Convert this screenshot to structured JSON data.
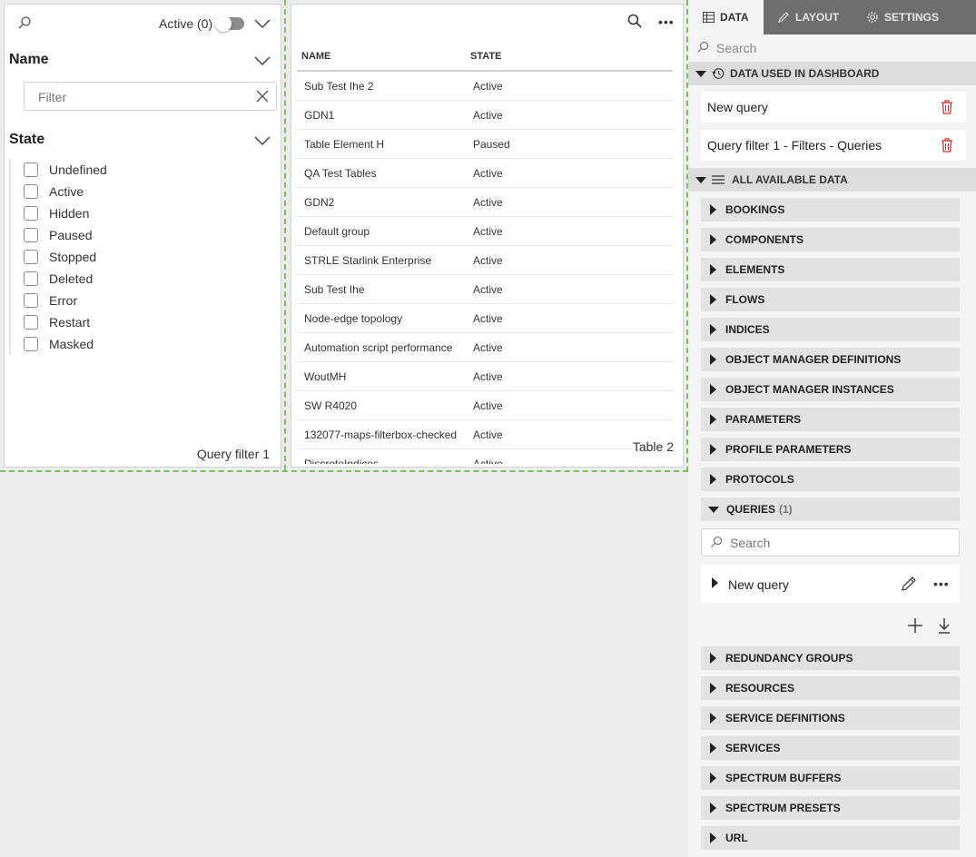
{
  "query_filter": {
    "active_toggle_label": "Active (0)",
    "sections": {
      "name_title": "Name",
      "name_filter_placeholder": "Filter",
      "state_title": "State"
    },
    "states": [
      "Undefined",
      "Active",
      "Hidden",
      "Paused",
      "Stopped",
      "Deleted",
      "Error",
      "Restart",
      "Masked"
    ],
    "caption": "Query filter 1"
  },
  "table": {
    "columns": [
      "NAME",
      "STATE"
    ],
    "rows": [
      {
        "name": "Sub Test Ihe 2",
        "state": "Active"
      },
      {
        "name": "GDN1",
        "state": "Active"
      },
      {
        "name": "Table Element H",
        "state": "Paused"
      },
      {
        "name": "QA Test Tables",
        "state": "Active"
      },
      {
        "name": "GDN2",
        "state": "Active"
      },
      {
        "name": "Default group",
        "state": "Active"
      },
      {
        "name": "STRLE Starlink Enterprise",
        "state": "Active"
      },
      {
        "name": "Sub Test Ihe",
        "state": "Active"
      },
      {
        "name": "Node-edge topology",
        "state": "Active"
      },
      {
        "name": "Automation script performance",
        "state": "Active"
      },
      {
        "name": "WoutMH",
        "state": "Active"
      },
      {
        "name": "SW R4020",
        "state": "Active"
      },
      {
        "name": "132077-maps-filterbox-checked",
        "state": "Active"
      },
      {
        "name": "DiscreteIndices",
        "state": "Active"
      }
    ],
    "caption": "Table 2"
  },
  "panel": {
    "tabs": {
      "data": "DATA",
      "layout": "LAYOUT",
      "settings": "SETTINGS"
    },
    "search_placeholder": "Search",
    "used_header": "DATA USED IN DASHBOARD",
    "used_items": [
      "New query",
      "Query filter 1 - Filters - Queries"
    ],
    "all_header": "ALL AVAILABLE DATA",
    "categories_top": [
      "BOOKINGS",
      "COMPONENTS",
      "ELEMENTS",
      "FLOWS",
      "INDICES",
      "OBJECT MANAGER DEFINITIONS",
      "OBJECT MANAGER INSTANCES",
      "PARAMETERS",
      "PROFILE PARAMETERS",
      "PROTOCOLS"
    ],
    "queries": {
      "label": "QUERIES",
      "count": "(1)",
      "search_placeholder": "Search",
      "items": [
        "New query"
      ]
    },
    "categories_bottom": [
      "REDUNDANCY GROUPS",
      "RESOURCES",
      "SERVICE DEFINITIONS",
      "SERVICES",
      "SPECTRUM BUFFERS",
      "SPECTRUM PRESETS",
      "URL"
    ]
  },
  "colors": {
    "accent_dashed": "#7cc05a",
    "tab_bar": "#6e6e6e",
    "trash_red": "#c0392b"
  }
}
